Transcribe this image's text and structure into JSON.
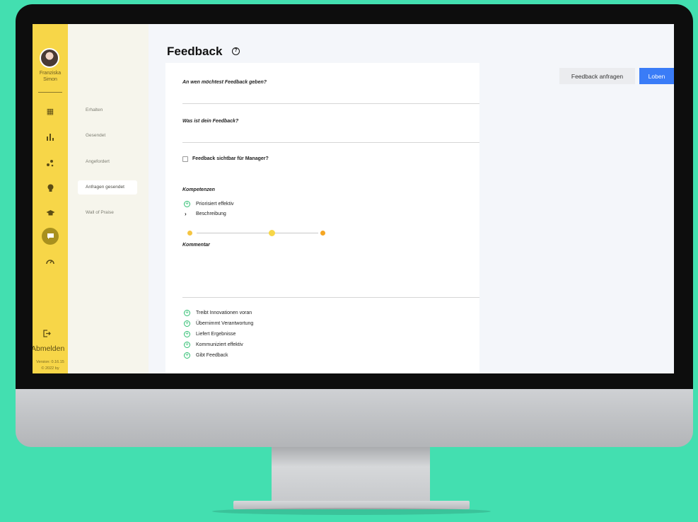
{
  "user": {
    "name_line1": "Franziska",
    "name_line2": "Simon"
  },
  "sidebar": {
    "icons": [
      "dashboard-icon",
      "bar-chart-icon",
      "network-icon",
      "lightbulb-icon",
      "graduation-cap-icon",
      "chat-icon",
      "speedometer-icon"
    ],
    "logout_label": "Abmelden",
    "version_line1": "Version: 0.16.15",
    "version_line2": "© 2022 by"
  },
  "subnav": {
    "items": [
      {
        "label": "Erhalten"
      },
      {
        "label": "Gesendet"
      },
      {
        "label": "Angefordert"
      },
      {
        "label": "Anfragen gesendet"
      },
      {
        "label": "Wall of Praise"
      }
    ],
    "active_index": 3
  },
  "header": {
    "title": "Feedback",
    "help_glyph": "?"
  },
  "actions": {
    "request_label": "Feedback anfragen",
    "praise_label": "Loben"
  },
  "form": {
    "q1": "An wen möchtest Feedback geben?",
    "q2": "Was ist dein Feedback?",
    "visible_to_manager": "Feedback sichtbar für Manager?",
    "competencies_heading": "Kompetenzen",
    "first_competency": "Priorisiert effektiv",
    "description_label": "Beschreibung",
    "comment_label": "Kommentar",
    "other_competencies": [
      "Treibt Innovationen voran",
      "Übernimmt Verantwortung",
      "Liefert Ergebnisse",
      "Kommuniziert effektiv",
      "Gibt Feedback"
    ]
  },
  "colors": {
    "accent_yellow": "#f7d648",
    "primary_blue": "#3a7cf7",
    "plus_green": "#2fbf71",
    "background": "#43dfb0"
  }
}
